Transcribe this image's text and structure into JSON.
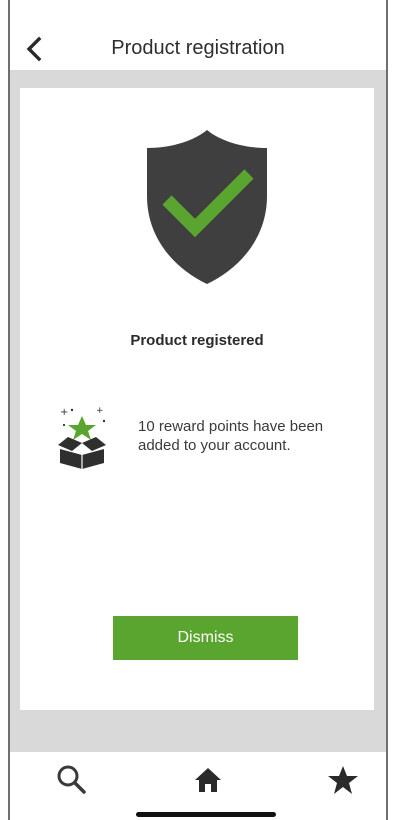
{
  "header": {
    "title": "Product registration",
    "back_icon": "chevron-left-icon"
  },
  "content": {
    "status_icon": "shield-check-icon",
    "status_title": "Product registered",
    "reward_icon": "gift-box-star-icon",
    "reward_message": "10 reward points have been added to your account.",
    "dismiss_label": "Dismiss"
  },
  "bottom_nav": {
    "items": [
      {
        "icon": "search-icon"
      },
      {
        "icon": "home-icon"
      },
      {
        "icon": "star-icon"
      }
    ]
  },
  "colors": {
    "accent_green": "#5aa52f",
    "shield_gray": "#3f3f3f",
    "background_gray": "#d9d9d9"
  }
}
